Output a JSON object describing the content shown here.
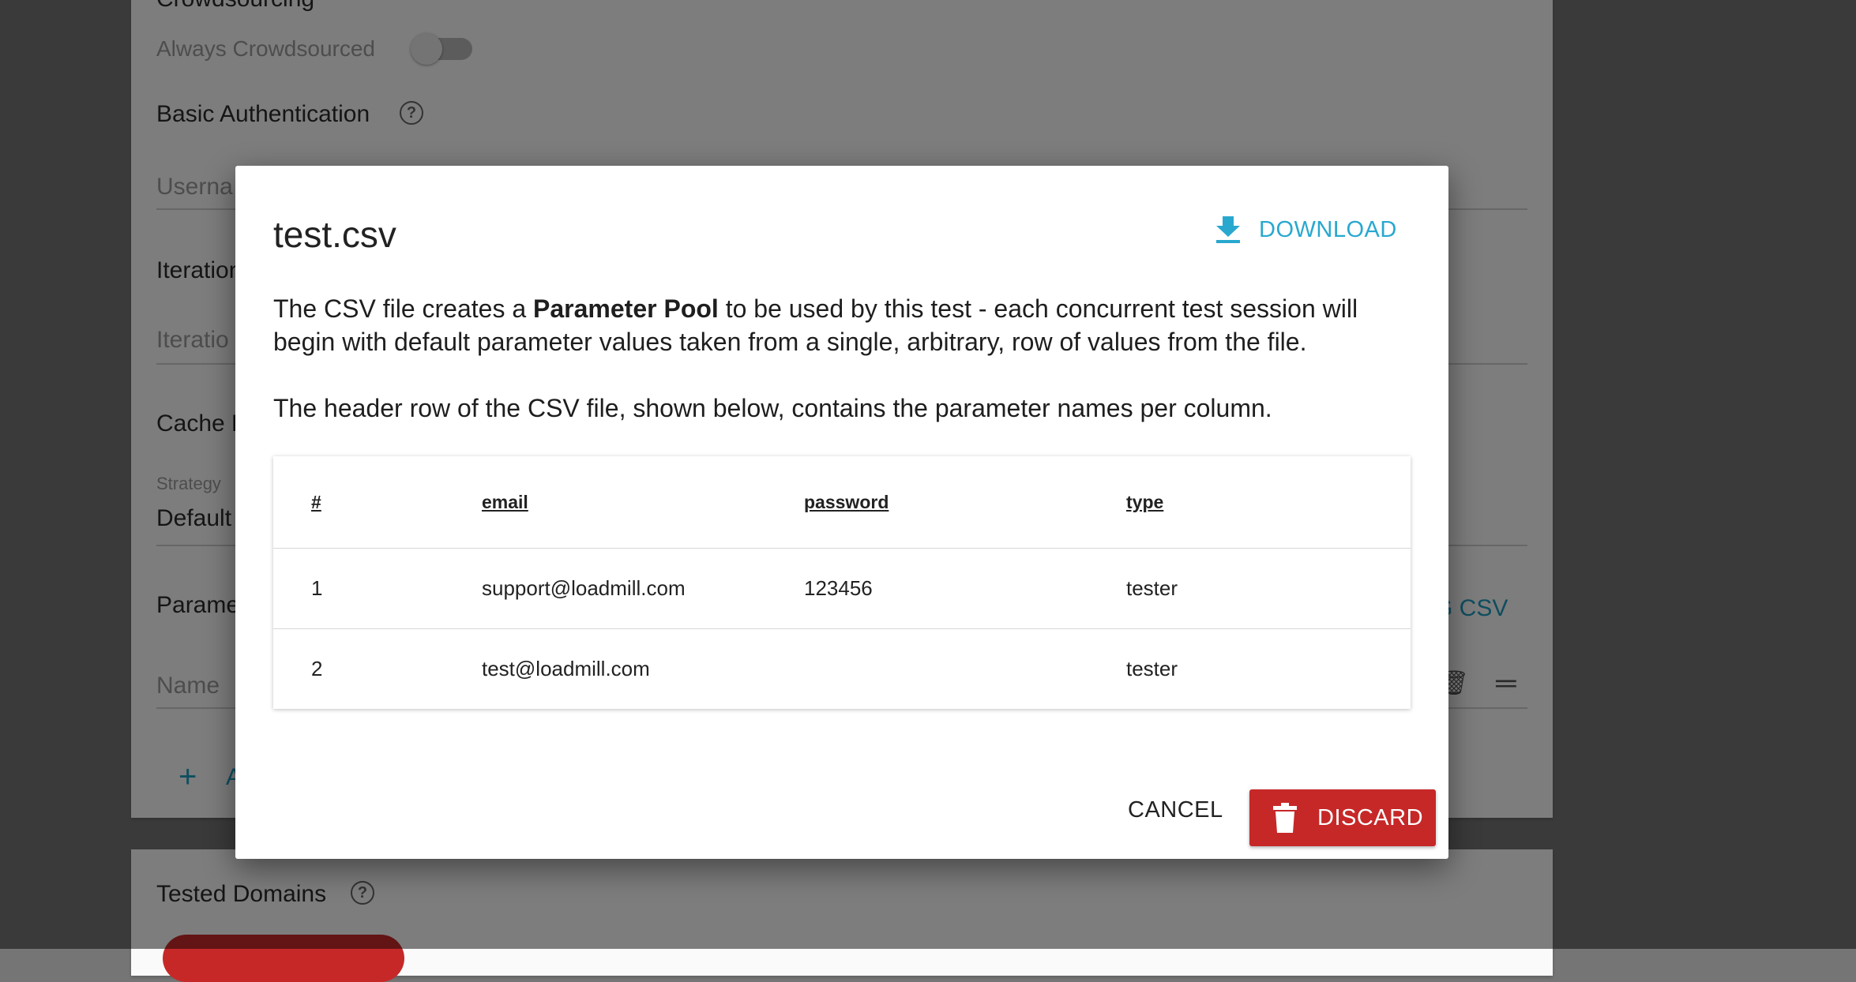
{
  "background": {
    "crowdsourcing_label": "Crowdsourcing",
    "always_crowdsourced_label": "Always Crowdsourced",
    "basic_auth_label": "Basic Authentication",
    "username_placeholder": "Userna",
    "iterations_label": "Iteration",
    "iterations_placeholder": "Iteratio",
    "cache_label": "Cache F",
    "strategy_label": "Strategy",
    "strategy_value": "Default",
    "parameters_label": "Parame",
    "csv_link_text": "G CSV",
    "name_placeholder": "Name",
    "add_text": "A",
    "tested_domains_label": "Tested Domains"
  },
  "dialog": {
    "title": "test.csv",
    "download_label": "DOWNLOAD",
    "intro_before": "The CSV file creates a ",
    "intro_bold": "Parameter Pool",
    "intro_after": " to be used by this test - each concurrent test session will begin with default parameter values taken from a single, arbitrary, row of values from the file.",
    "header_note": "The header row of the CSV file, shown below, contains the parameter names per column.",
    "table": {
      "columns": [
        "#",
        "email",
        "password",
        "type"
      ],
      "rows": [
        [
          "1",
          "support@loadmill.com",
          "123456",
          "tester"
        ],
        [
          "2",
          "test@loadmill.com",
          "",
          "tester"
        ]
      ]
    },
    "cancel_label": "CANCEL",
    "discard_label": "DISCARD"
  },
  "colors": {
    "accent": "#29a8cf",
    "danger": "#c62828"
  }
}
